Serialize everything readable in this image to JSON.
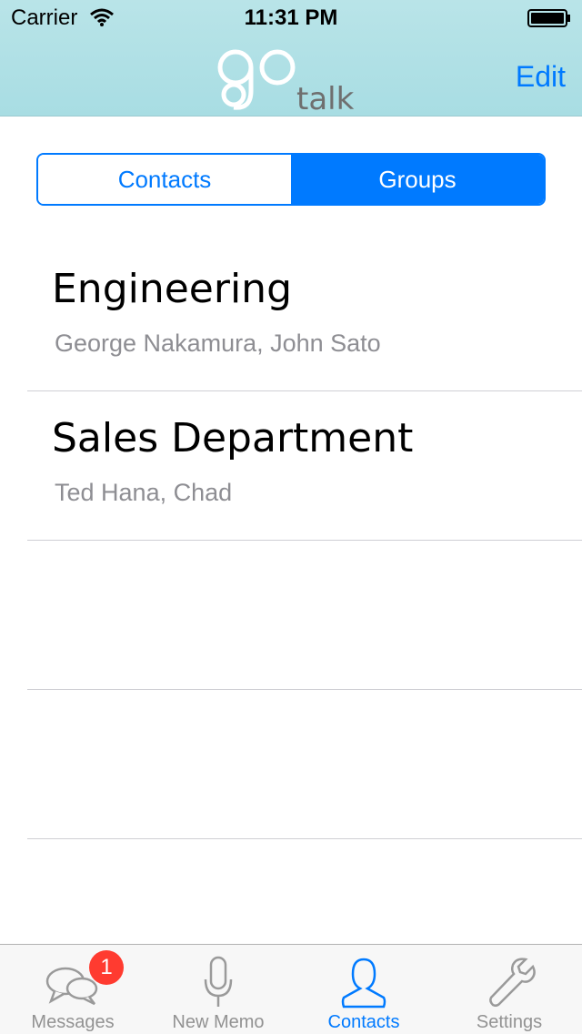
{
  "status_bar": {
    "carrier": "Carrier",
    "time": "11:31 PM"
  },
  "header": {
    "logo_text_go": "go",
    "logo_text_talk": "talk",
    "edit_label": "Edit"
  },
  "segmented": {
    "contacts_label": "Contacts",
    "groups_label": "Groups",
    "selected": "Groups"
  },
  "groups": [
    {
      "name": "Engineering",
      "members": "George Nakamura, John Sato"
    },
    {
      "name": "Sales Department",
      "members": "Ted Hana, Chad"
    }
  ],
  "tabbar": {
    "items": [
      {
        "label": "Messages",
        "icon": "messages-icon",
        "badge": "1"
      },
      {
        "label": "New Memo",
        "icon": "microphone-icon"
      },
      {
        "label": "Contacts",
        "icon": "contact-person-icon"
      },
      {
        "label": "Settings",
        "icon": "wrench-icon"
      }
    ],
    "active": "Contacts"
  },
  "colors": {
    "accent": "#007aff",
    "header": "#b9e4e8",
    "badge": "#ff3b30"
  }
}
